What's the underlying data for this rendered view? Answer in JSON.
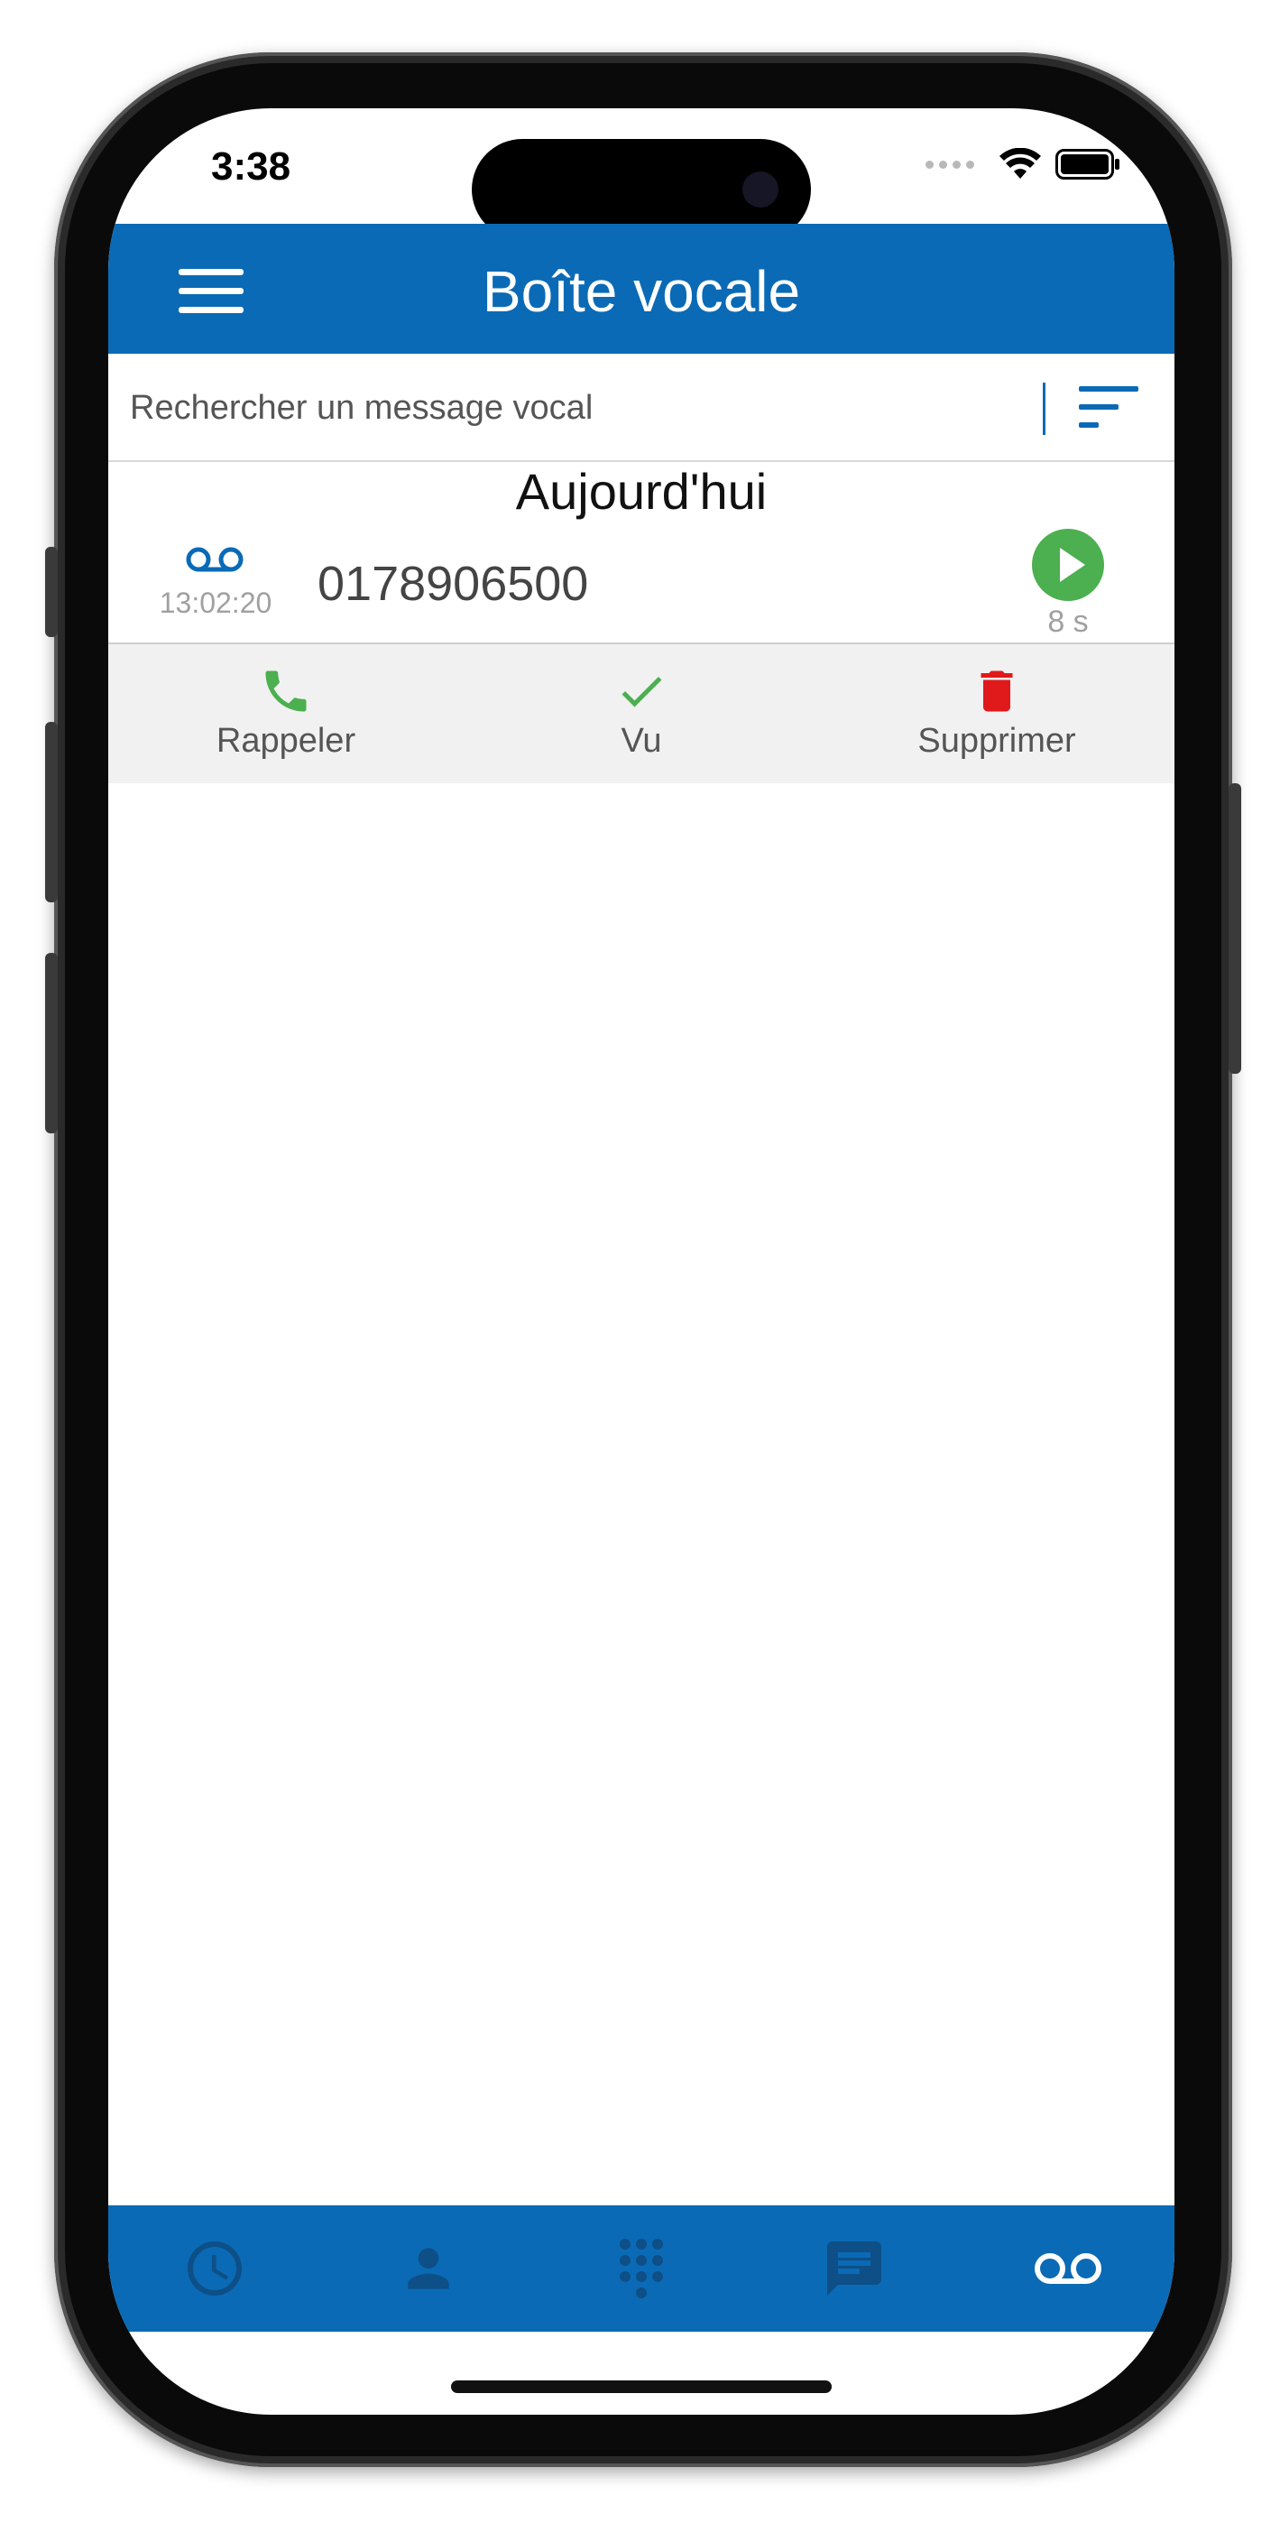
{
  "status_bar": {
    "time": "3:38"
  },
  "header": {
    "title": "Boîte vocale"
  },
  "search": {
    "placeholder": "Rechercher un message vocal"
  },
  "section": {
    "title": "Aujourd'hui"
  },
  "messages": [
    {
      "time": "13:02:20",
      "number": "0178906500",
      "duration": "8 s"
    }
  ],
  "actions": {
    "callback": "Rappeler",
    "seen": "Vu",
    "delete": "Supprimer"
  },
  "nav": {
    "items": [
      "clock-icon",
      "contact-icon",
      "dialpad-icon",
      "chat-icon",
      "voicemail-icon"
    ],
    "active": "voicemail"
  },
  "colors": {
    "brand": "#0a6ab5",
    "nav_inactive": "#0d4f86",
    "green": "#4caf50",
    "red": "#e0191b",
    "secondary_text": "#a0a0a0"
  },
  "icons": {
    "menu": "hamburger-icon",
    "sort": "sort-icon",
    "message_type": "voicemail-icon",
    "play": "play-icon",
    "callback": "phone-icon",
    "seen": "check-icon",
    "delete": "trash-icon"
  }
}
